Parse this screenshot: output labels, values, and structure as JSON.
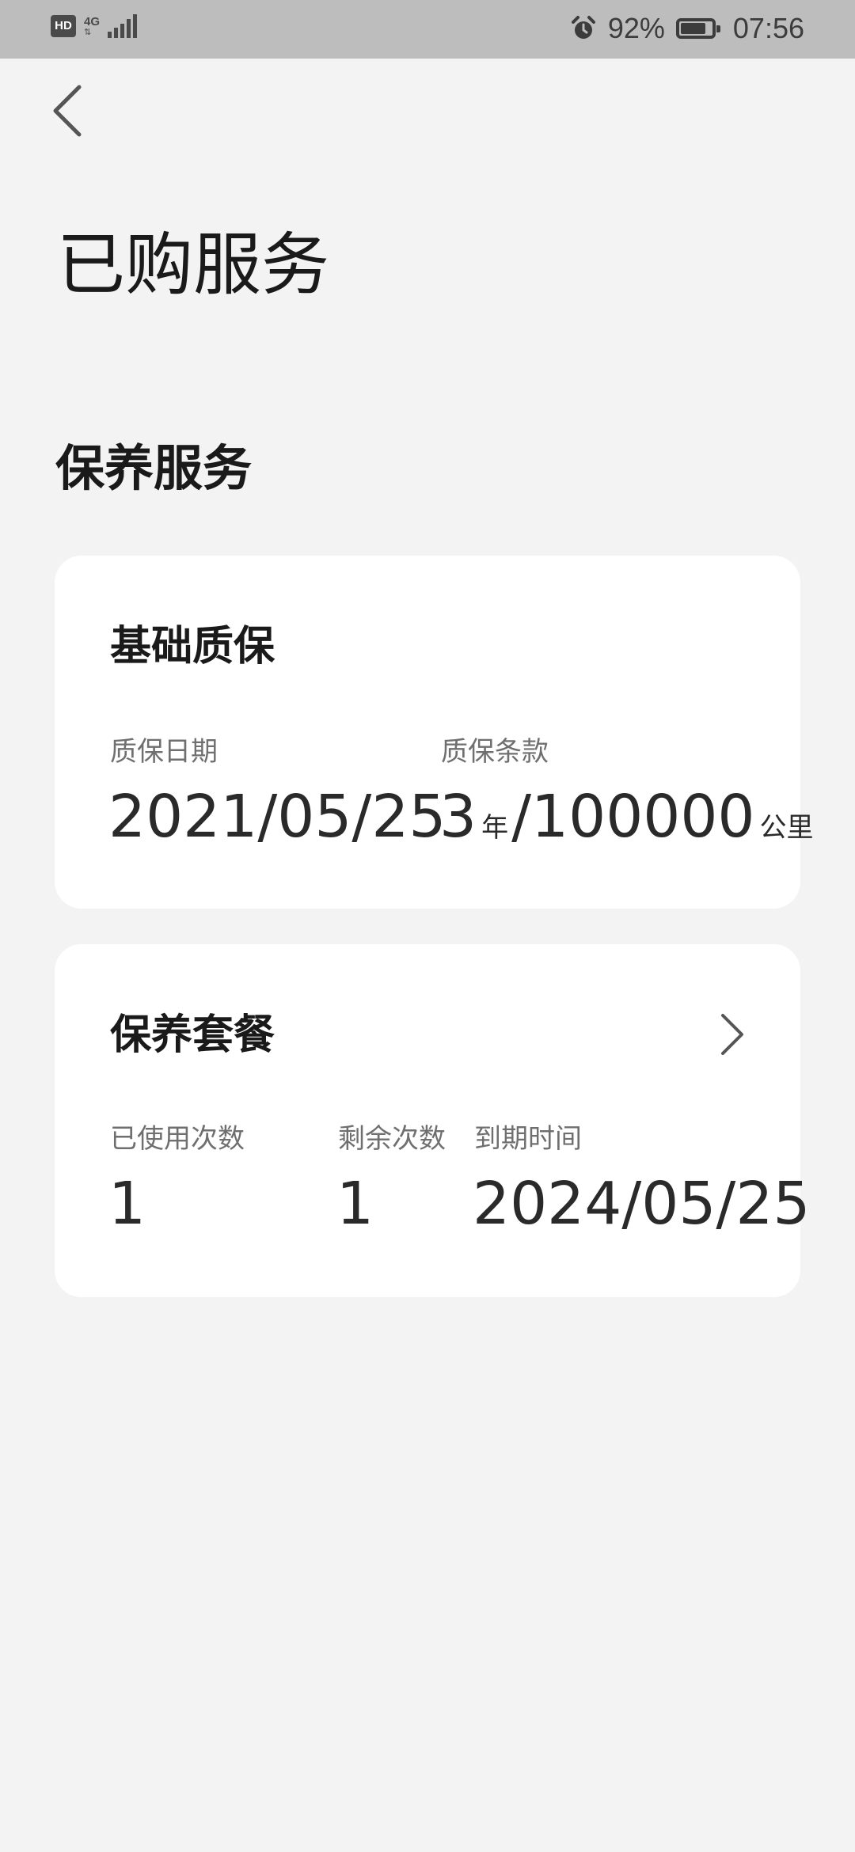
{
  "status_bar": {
    "hd_label": "HD",
    "network_label": "4G",
    "signal_bars": 5,
    "battery_percent": "92%",
    "battery_level": 0.92,
    "time": "07:56"
  },
  "header": {
    "title": "已购服务"
  },
  "section": {
    "title": "保养服务"
  },
  "warranty_card": {
    "title": "基础质保",
    "date_label": "质保日期",
    "date_value": "2021/05/25",
    "terms_label": "质保条款",
    "terms_years": "3",
    "terms_years_unit": "年",
    "terms_km": "/100000",
    "terms_km_unit": "公里"
  },
  "package_card": {
    "title": "保养套餐",
    "used_label": "已使用次数",
    "used_value": "1",
    "remaining_label": "剩余次数",
    "remaining_value": "1",
    "expiry_label": "到期时间",
    "expiry_value": "2024/05/25"
  },
  "icons": {
    "back": "chevron-left-icon",
    "detail": "chevron-right-icon",
    "alarm": "alarm-icon",
    "battery": "battery-icon",
    "signal": "signal-icon"
  },
  "colors": {
    "background": "#f3f3f3",
    "card": "#ffffff",
    "status_bar": "#bdbdbd",
    "label": "#6f6f6f",
    "text": "#1a1a1a"
  }
}
